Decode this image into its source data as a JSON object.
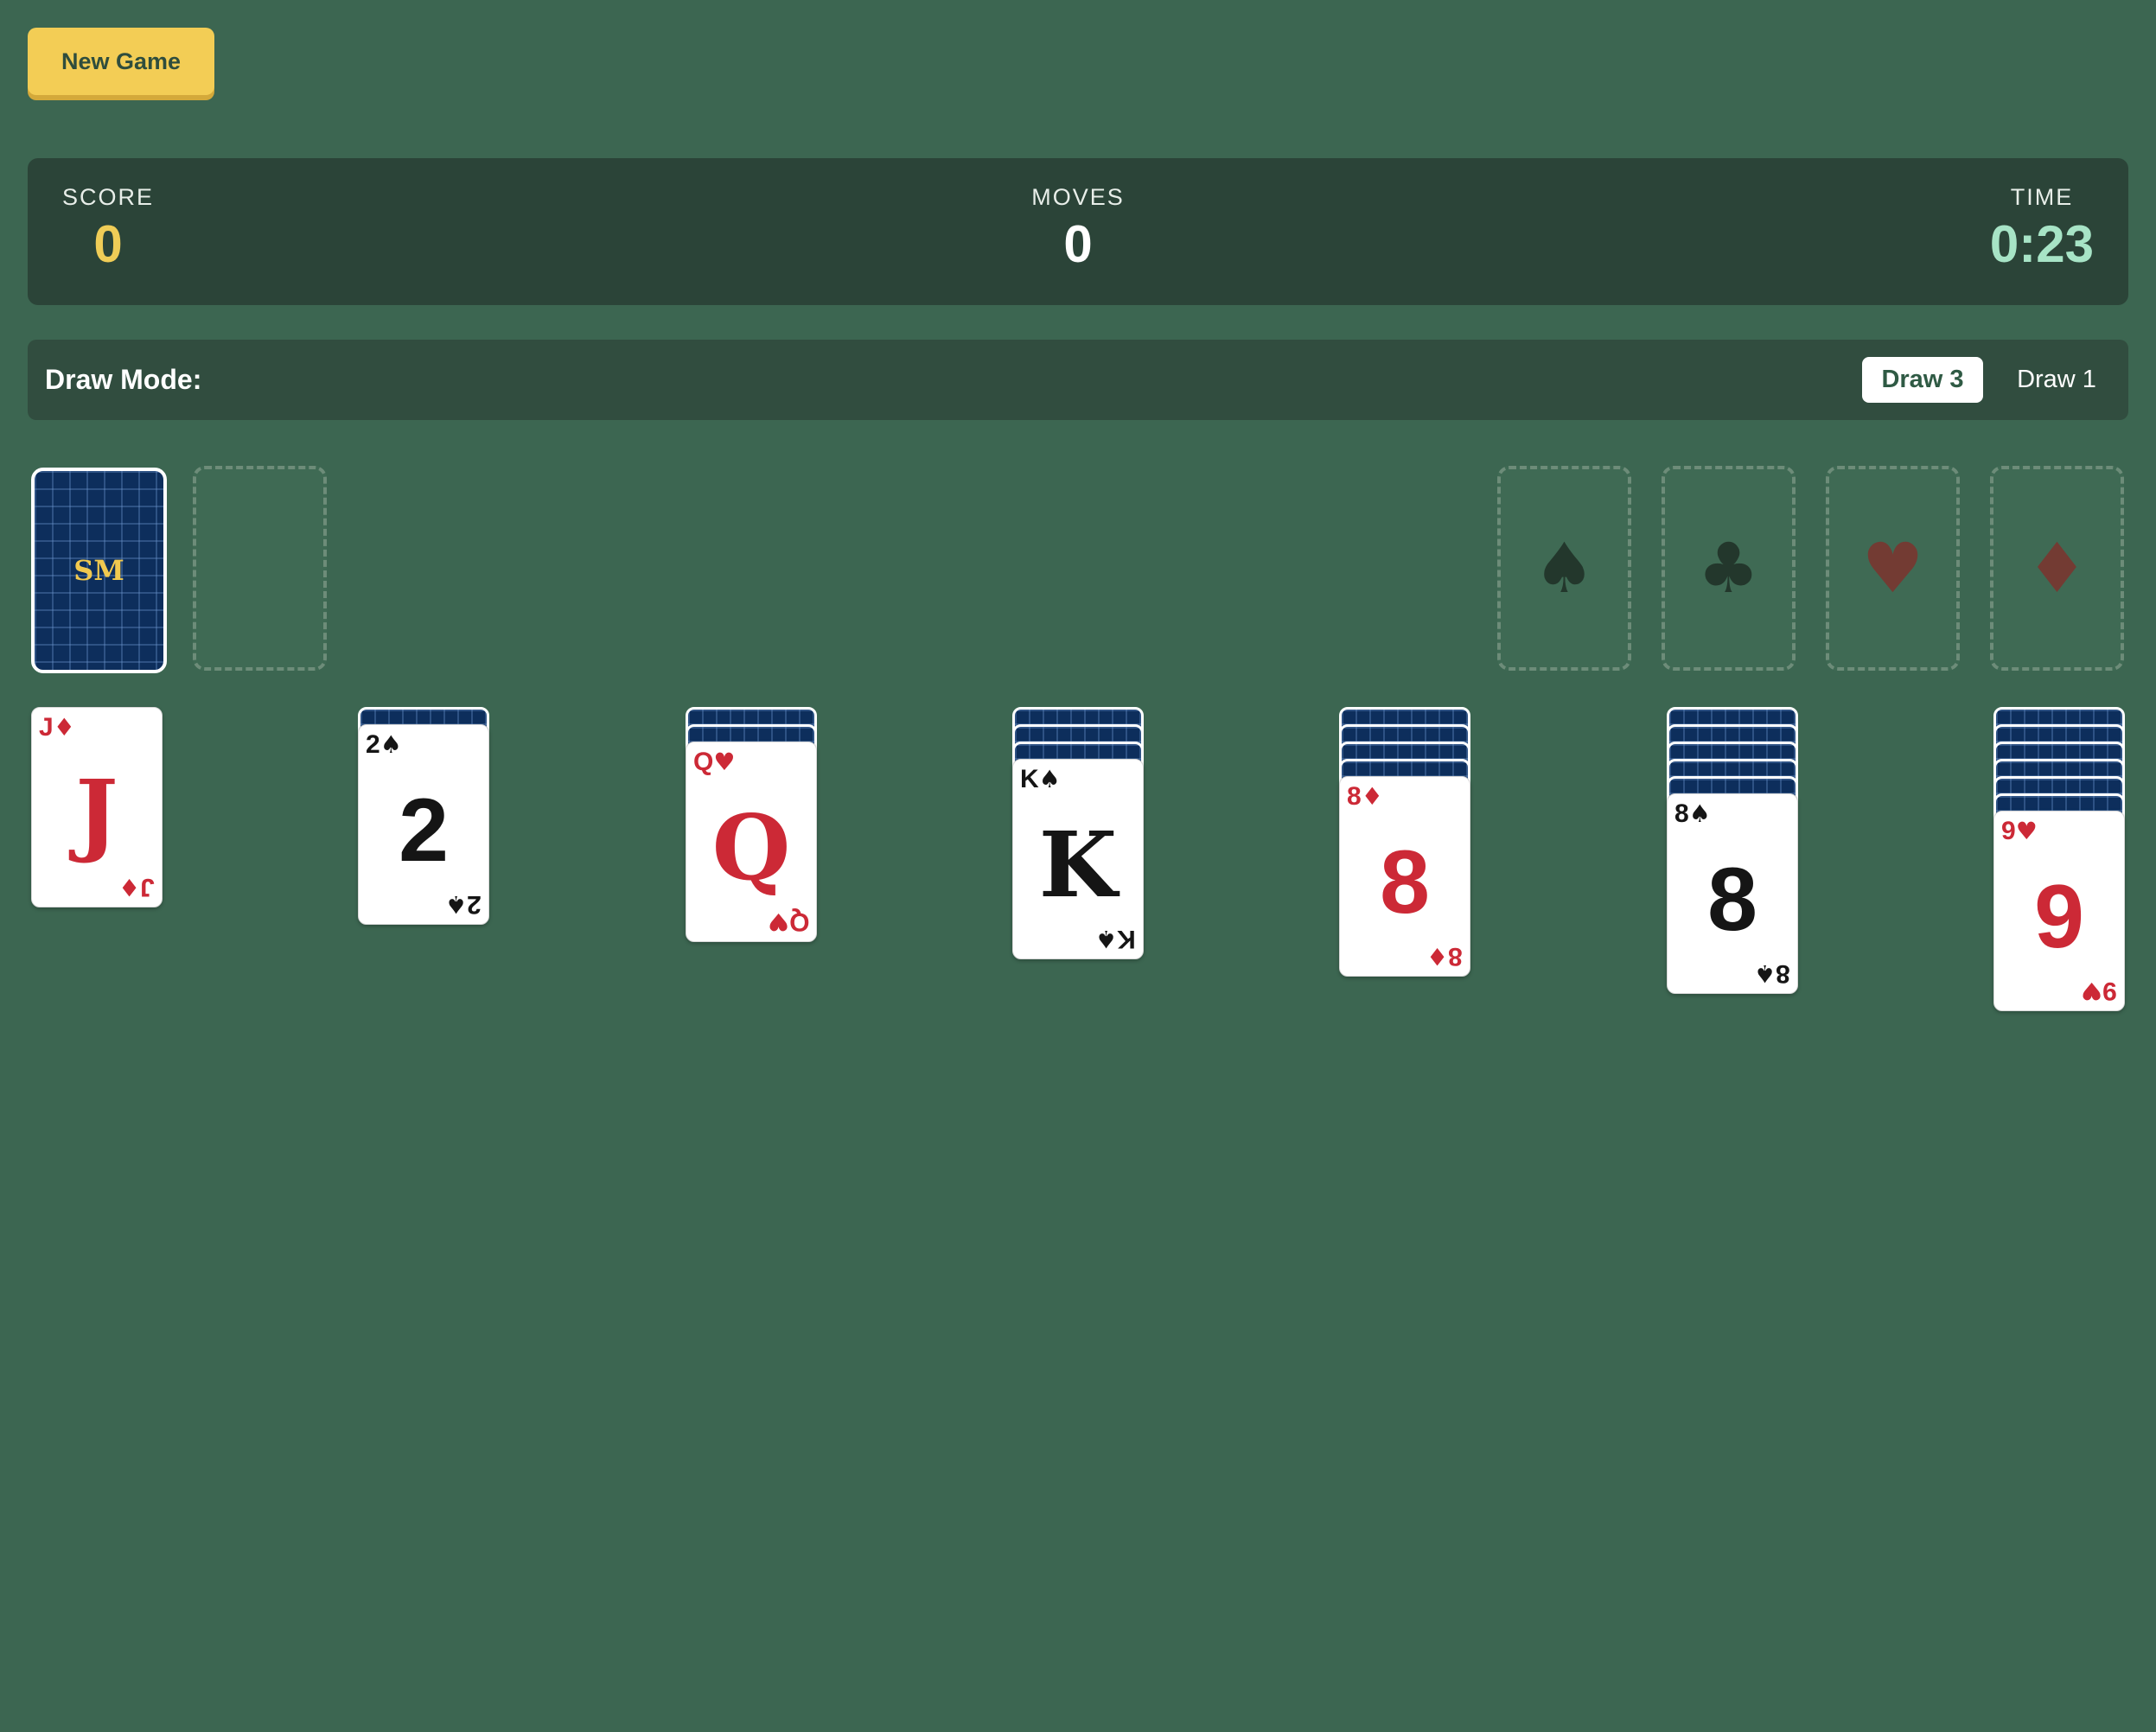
{
  "toolbar": {
    "new_game_label": "New Game"
  },
  "stats": {
    "score_label": "SCORE",
    "score_value": "0",
    "moves_label": "MOVES",
    "moves_value": "0",
    "time_label": "TIME",
    "time_value": "0:23"
  },
  "draw_mode": {
    "label": "Draw Mode:",
    "options": [
      "Draw 3",
      "Draw 1"
    ],
    "selected": "Draw 3"
  },
  "stock": {
    "logo": "SM"
  },
  "foundations": [
    {
      "suit": "spades",
      "symbol": "♠"
    },
    {
      "suit": "clubs",
      "symbol": "♣"
    },
    {
      "suit": "hearts",
      "symbol": "♥"
    },
    {
      "suit": "diamonds",
      "symbol": "♦"
    }
  ],
  "tableau": [
    {
      "hidden": 0,
      "card": {
        "rank": "J",
        "suit": "diamonds",
        "symbol": "♦",
        "color": "red"
      }
    },
    {
      "hidden": 1,
      "card": {
        "rank": "2",
        "suit": "spades",
        "symbol": "♠",
        "color": "black"
      }
    },
    {
      "hidden": 2,
      "card": {
        "rank": "Q",
        "suit": "hearts",
        "symbol": "♥",
        "color": "red"
      }
    },
    {
      "hidden": 3,
      "card": {
        "rank": "K",
        "suit": "spades",
        "symbol": "♠",
        "color": "black"
      }
    },
    {
      "hidden": 4,
      "card": {
        "rank": "8",
        "suit": "diamonds",
        "symbol": "♦",
        "color": "red"
      }
    },
    {
      "hidden": 5,
      "card": {
        "rank": "8",
        "suit": "spades",
        "symbol": "♠",
        "color": "black"
      }
    },
    {
      "hidden": 6,
      "card": {
        "rank": "9",
        "suit": "hearts",
        "symbol": "♥",
        "color": "red"
      }
    }
  ]
}
